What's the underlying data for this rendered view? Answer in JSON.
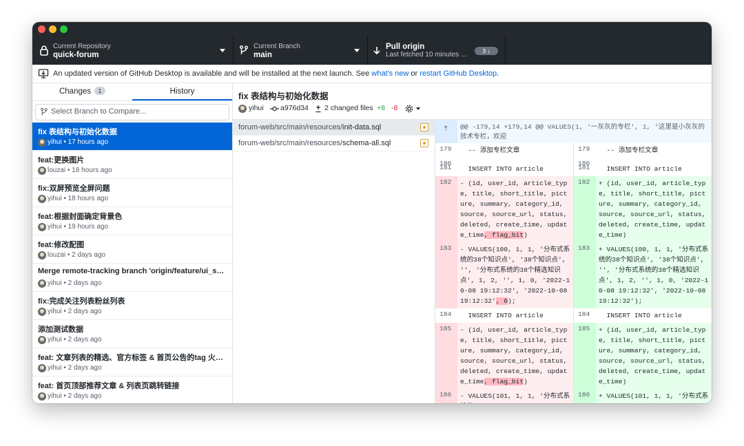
{
  "toolbar": {
    "repo_label": "Current Repository",
    "repo_name": "quick-forum",
    "branch_label": "Current Branch",
    "branch_name": "main",
    "pull_title": "Pull origin",
    "pull_subtitle": "Last fetched 10 minutes ...",
    "pull_count": "3 ↓"
  },
  "banner": {
    "text_before": "An updated version of GitHub Desktop is available and will be installed at the next launch. See ",
    "link_whats_new": "what's new",
    "text_or": " or ",
    "link_restart": "restart GitHub Desktop",
    "text_after": "."
  },
  "tabs": {
    "changes_label": "Changes",
    "changes_count": "1",
    "history_label": "History"
  },
  "compare": {
    "placeholder": "Select Branch to Compare..."
  },
  "commits": [
    {
      "summary": "fix 表结构与初始化数据",
      "meta": "yihui • 17 hours ago"
    },
    {
      "summary": "feat:更换图片",
      "meta": "louzai • 18 hours ago"
    },
    {
      "summary": "fix:双屏预览全屏问题",
      "meta": "yihui • 18 hours ago"
    },
    {
      "summary": "feat:根据封面确定背景色",
      "meta": "yihui • 19 hours ago"
    },
    {
      "summary": "feat:修改配图",
      "meta": "louzai • 2 days ago"
    },
    {
      "summary": "Merge remote-tracking branch 'origin/feature/ui_sh...",
      "meta": "yihui • 2 days ago"
    },
    {
      "summary": "fix:完成关注列表粉丝列表",
      "meta": "yihui • 2 days ago"
    },
    {
      "summary": "添加测试数据",
      "meta": "yihui • 2 days ago"
    },
    {
      "summary": "feat: 文章列表的精选、官方标签 & 首页公告的tag 火标签",
      "meta": "yihui • 2 days ago"
    },
    {
      "summary": "feat: 首页顶部推荐文章 & 列表页跳转链接",
      "meta": "yihui • 2 days ago"
    }
  ],
  "commit_detail": {
    "title": "fix 表结构与初始化数据",
    "author": "yihui",
    "sha": "a976d34",
    "changed_files": "2 changed files",
    "additions": "+8",
    "deletions": "-8"
  },
  "files": [
    {
      "dir": "forum-web/src/main/resources/",
      "name": "init-data.sql"
    },
    {
      "dir": "forum-web/src/main/resources/",
      "name": "schema-all.sql"
    }
  ],
  "diff": {
    "hunk_header": "@@ -179,14 +179,14 @@ VALUES(1, '一灰灰的专栏', 1, '这里是小灰灰的技术专栏，欢迎",
    "left": [
      {
        "num": "179",
        "type": "ctx",
        "a": "  -- 添加专栏文章"
      },
      {
        "num": "180",
        "type": "ctx",
        "a": ""
      },
      {
        "num": "181",
        "type": "ctx",
        "a": "  INSERT INTO article"
      },
      {
        "num": "182",
        "type": "del",
        "a": "- (id, user_id, article_type, title, short_title, picture, summary, category_id, source, source_url, status, deleted, create_time, update_time",
        "hl": ", flag_bit",
        "b": ")"
      },
      {
        "num": "183",
        "type": "del",
        "a": "- VALUES(100, 1, 1, '分布式系统的38个知识点', '38个知识点', '', '分布式系统的38个精选知识点', 1, 2, '', 1, 0, '2022-10-08 19:12:32', '2022-10-08 19:12:32'",
        "hl": ", 0",
        "b": ");"
      },
      {
        "num": "184",
        "type": "ctx",
        "a": "  INSERT INTO article"
      },
      {
        "num": "185",
        "type": "del",
        "a": "- (id, user_id, article_type, title, short_title, picture, summary, category_id, source, source_url, status, deleted, create_time, update_time",
        "hl": ", flag_bit",
        "b": ")"
      },
      {
        "num": "186",
        "type": "del",
        "a": "- VALUES(101, 1, 1, '分布式系统的",
        "hl": "",
        "b": ""
      }
    ],
    "right": [
      {
        "num": "179",
        "type": "ctx",
        "a": "  -- 添加专栏文章"
      },
      {
        "num": "180",
        "type": "ctx",
        "a": ""
      },
      {
        "num": "181",
        "type": "ctx",
        "a": "  INSERT INTO article"
      },
      {
        "num": "182",
        "type": "add",
        "a": "+ (id, user_id, article_type, title, short_title, picture, summary, category_id, source, source_url, status, deleted, create_time, update_time)",
        "hl": "",
        "b": ""
      },
      {
        "num": "183",
        "type": "add",
        "a": "+ VALUES(100, 1, 1, '分布式系统的38个知识点', '38个知识点', '', '分布式系统的38个精选知识点', 1, 2, '', 1, 0, '2022-10-08 19:12:32', '2022-10-08 19:12:32');",
        "hl": "",
        "b": ""
      },
      {
        "num": "184",
        "type": "ctx",
        "a": "  INSERT INTO article"
      },
      {
        "num": "185",
        "type": "add",
        "a": "+ (id, user_id, article_type, title, short_title, picture, summary, category_id, source, source_url, status, deleted, create_time, update_time)",
        "hl": "",
        "b": ""
      },
      {
        "num": "186",
        "type": "add",
        "a": "+ VALUES(101, 1, 1, '分布式系",
        "hl": "",
        "b": ""
      }
    ]
  }
}
